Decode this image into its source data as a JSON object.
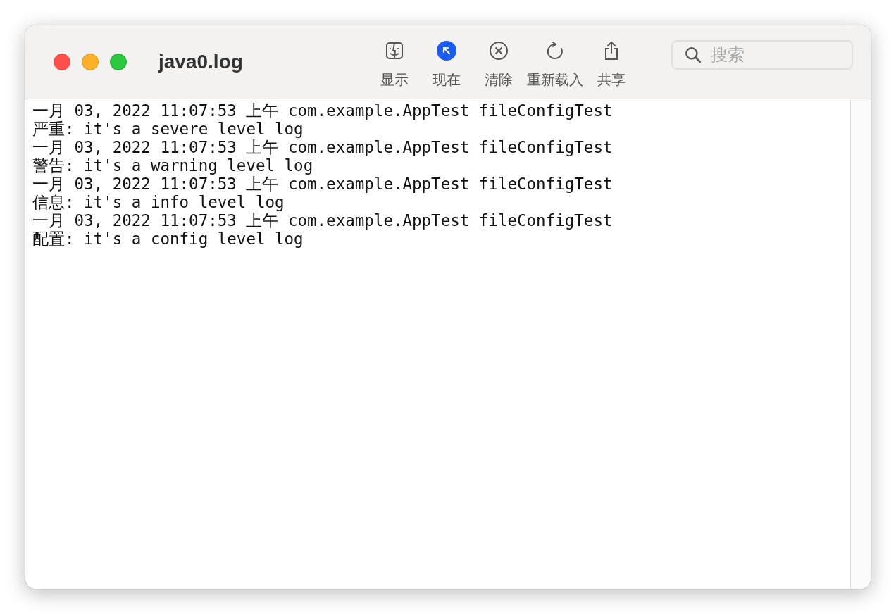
{
  "window": {
    "title": "java0.log"
  },
  "toolbar": [
    {
      "label": "显示",
      "kind": "finder",
      "selected": false
    },
    {
      "label": "现在",
      "kind": "now",
      "selected": true
    },
    {
      "label": "清除",
      "kind": "clear",
      "selected": false
    },
    {
      "label": "重新载入",
      "kind": "reload",
      "selected": false
    },
    {
      "label": "共享",
      "kind": "share",
      "selected": false
    }
  ],
  "search": {
    "placeholder": "搜索"
  },
  "log_lines": [
    "一月 03, 2022 11:07:53 上午 com.example.AppTest fileConfigTest",
    "严重: it's a severe level log",
    "一月 03, 2022 11:07:53 上午 com.example.AppTest fileConfigTest",
    "警告: it's a warning level log",
    "一月 03, 2022 11:07:53 上午 com.example.AppTest fileConfigTest",
    "信息: it's a info level log",
    "一月 03, 2022 11:07:53 上午 com.example.AppTest fileConfigTest",
    "配置: it's a config level log"
  ]
}
